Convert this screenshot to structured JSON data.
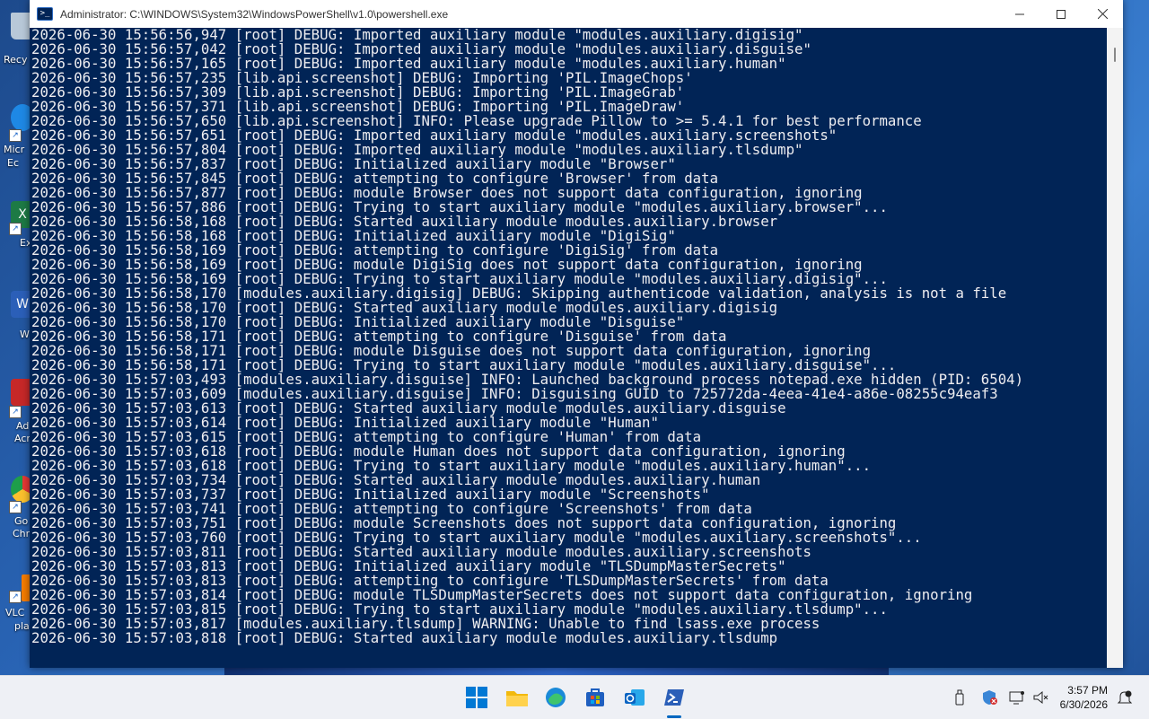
{
  "desktop": {
    "icons": [
      {
        "label": "Recy",
        "color": "#9fb3c8"
      },
      {
        "label": "Micr",
        "color": "#1e88e5"
      },
      {
        "label": "Ex",
        "color": "#1d7a45"
      },
      {
        "label": "W",
        "color": "#2b5fb8"
      },
      {
        "label": "Ad",
        "color": "#c62828"
      },
      {
        "label": "Go",
        "color": "#1e9e4a"
      },
      {
        "label": "VLC",
        "color": "#f57c00"
      }
    ],
    "icon_extra_labels": [
      "Ec",
      "Acr",
      "Chr",
      "pla"
    ]
  },
  "window": {
    "title": "Administrator: C:\\WINDOWS\\System32\\WindowsPowerShell\\v1.0\\powershell.exe",
    "icon": "powershell-icon",
    "controls": {
      "minimize": "minimize-icon",
      "maximize": "maximize-icon",
      "close": "close-icon"
    }
  },
  "console": {
    "background": "#012456",
    "lines": [
      "2026-06-30 15:56:56,947 [root] DEBUG: Imported auxiliary module \"modules.auxiliary.digisig\"",
      "2026-06-30 15:56:57,042 [root] DEBUG: Imported auxiliary module \"modules.auxiliary.disguise\"",
      "2026-06-30 15:56:57,165 [root] DEBUG: Imported auxiliary module \"modules.auxiliary.human\"",
      "2026-06-30 15:56:57,235 [lib.api.screenshot] DEBUG: Importing 'PIL.ImageChops'",
      "2026-06-30 15:56:57,309 [lib.api.screenshot] DEBUG: Importing 'PIL.ImageGrab'",
      "2026-06-30 15:56:57,371 [lib.api.screenshot] DEBUG: Importing 'PIL.ImageDraw'",
      "2026-06-30 15:56:57,650 [lib.api.screenshot] INFO: Please upgrade Pillow to >= 5.4.1 for best performance",
      "2026-06-30 15:56:57,651 [root] DEBUG: Imported auxiliary module \"modules.auxiliary.screenshots\"",
      "2026-06-30 15:56:57,804 [root] DEBUG: Imported auxiliary module \"modules.auxiliary.tlsdump\"",
      "2026-06-30 15:56:57,837 [root] DEBUG: Initialized auxiliary module \"Browser\"",
      "2026-06-30 15:56:57,845 [root] DEBUG: attempting to configure 'Browser' from data",
      "2026-06-30 15:56:57,877 [root] DEBUG: module Browser does not support data configuration, ignoring",
      "2026-06-30 15:56:57,886 [root] DEBUG: Trying to start auxiliary module \"modules.auxiliary.browser\"...",
      "2026-06-30 15:56:58,168 [root] DEBUG: Started auxiliary module modules.auxiliary.browser",
      "2026-06-30 15:56:58,168 [root] DEBUG: Initialized auxiliary module \"DigiSig\"",
      "2026-06-30 15:56:58,169 [root] DEBUG: attempting to configure 'DigiSig' from data",
      "2026-06-30 15:56:58,169 [root] DEBUG: module DigiSig does not support data configuration, ignoring",
      "2026-06-30 15:56:58,169 [root] DEBUG: Trying to start auxiliary module \"modules.auxiliary.digisig\"...",
      "2026-06-30 15:56:58,170 [modules.auxiliary.digisig] DEBUG: Skipping authenticode validation, analysis is not a file",
      "2026-06-30 15:56:58,170 [root] DEBUG: Started auxiliary module modules.auxiliary.digisig",
      "2026-06-30 15:56:58,170 [root] DEBUG: Initialized auxiliary module \"Disguise\"",
      "2026-06-30 15:56:58,171 [root] DEBUG: attempting to configure 'Disguise' from data",
      "2026-06-30 15:56:58,171 [root] DEBUG: module Disguise does not support data configuration, ignoring",
      "2026-06-30 15:56:58,171 [root] DEBUG: Trying to start auxiliary module \"modules.auxiliary.disguise\"...",
      "2026-06-30 15:57:03,493 [modules.auxiliary.disguise] INFO: Launched background process notepad.exe hidden (PID: 6504)",
      "2026-06-30 15:57:03,609 [modules.auxiliary.disguise] INFO: Disguising GUID to 725772da-4eea-41e4-a86e-08255c94eaf3",
      "2026-06-30 15:57:03,613 [root] DEBUG: Started auxiliary module modules.auxiliary.disguise",
      "2026-06-30 15:57:03,614 [root] DEBUG: Initialized auxiliary module \"Human\"",
      "2026-06-30 15:57:03,615 [root] DEBUG: attempting to configure 'Human' from data",
      "2026-06-30 15:57:03,618 [root] DEBUG: module Human does not support data configuration, ignoring",
      "2026-06-30 15:57:03,618 [root] DEBUG: Trying to start auxiliary module \"modules.auxiliary.human\"...",
      "2026-06-30 15:57:03,734 [root] DEBUG: Started auxiliary module modules.auxiliary.human",
      "2026-06-30 15:57:03,737 [root] DEBUG: Initialized auxiliary module \"Screenshots\"",
      "2026-06-30 15:57:03,741 [root] DEBUG: attempting to configure 'Screenshots' from data",
      "2026-06-30 15:57:03,751 [root] DEBUG: module Screenshots does not support data configuration, ignoring",
      "2026-06-30 15:57:03,760 [root] DEBUG: Trying to start auxiliary module \"modules.auxiliary.screenshots\"...",
      "2026-06-30 15:57:03,811 [root] DEBUG: Started auxiliary module modules.auxiliary.screenshots",
      "2026-06-30 15:57:03,813 [root] DEBUG: Initialized auxiliary module \"TLSDumpMasterSecrets\"",
      "2026-06-30 15:57:03,813 [root] DEBUG: attempting to configure 'TLSDumpMasterSecrets' from data",
      "2026-06-30 15:57:03,814 [root] DEBUG: module TLSDumpMasterSecrets does not support data configuration, ignoring",
      "2026-06-30 15:57:03,815 [root] DEBUG: Trying to start auxiliary module \"modules.auxiliary.tlsdump\"...",
      "2026-06-30 15:57:03,817 [modules.auxiliary.tlsdump] WARNING: Unable to find lsass.exe process",
      "2026-06-30 15:57:03,818 [root] DEBUG: Started auxiliary module modules.auxiliary.tlsdump"
    ]
  },
  "taskbar": {
    "apps": [
      {
        "name": "start-button",
        "icon": "windows-logo-icon"
      },
      {
        "name": "file-explorer",
        "icon": "folder-icon"
      },
      {
        "name": "edge",
        "icon": "edge-icon"
      },
      {
        "name": "store",
        "icon": "store-icon"
      },
      {
        "name": "outlook",
        "icon": "outlook-icon"
      },
      {
        "name": "powershell",
        "icon": "powershell-icon",
        "active": true
      }
    ],
    "tray_icons": [
      "usb-icon",
      "security-icon",
      "network-icon",
      "volume-muted-icon"
    ],
    "time": "3:57 PM",
    "date": "6/30/2026",
    "notification_icon": "notification-icon"
  }
}
